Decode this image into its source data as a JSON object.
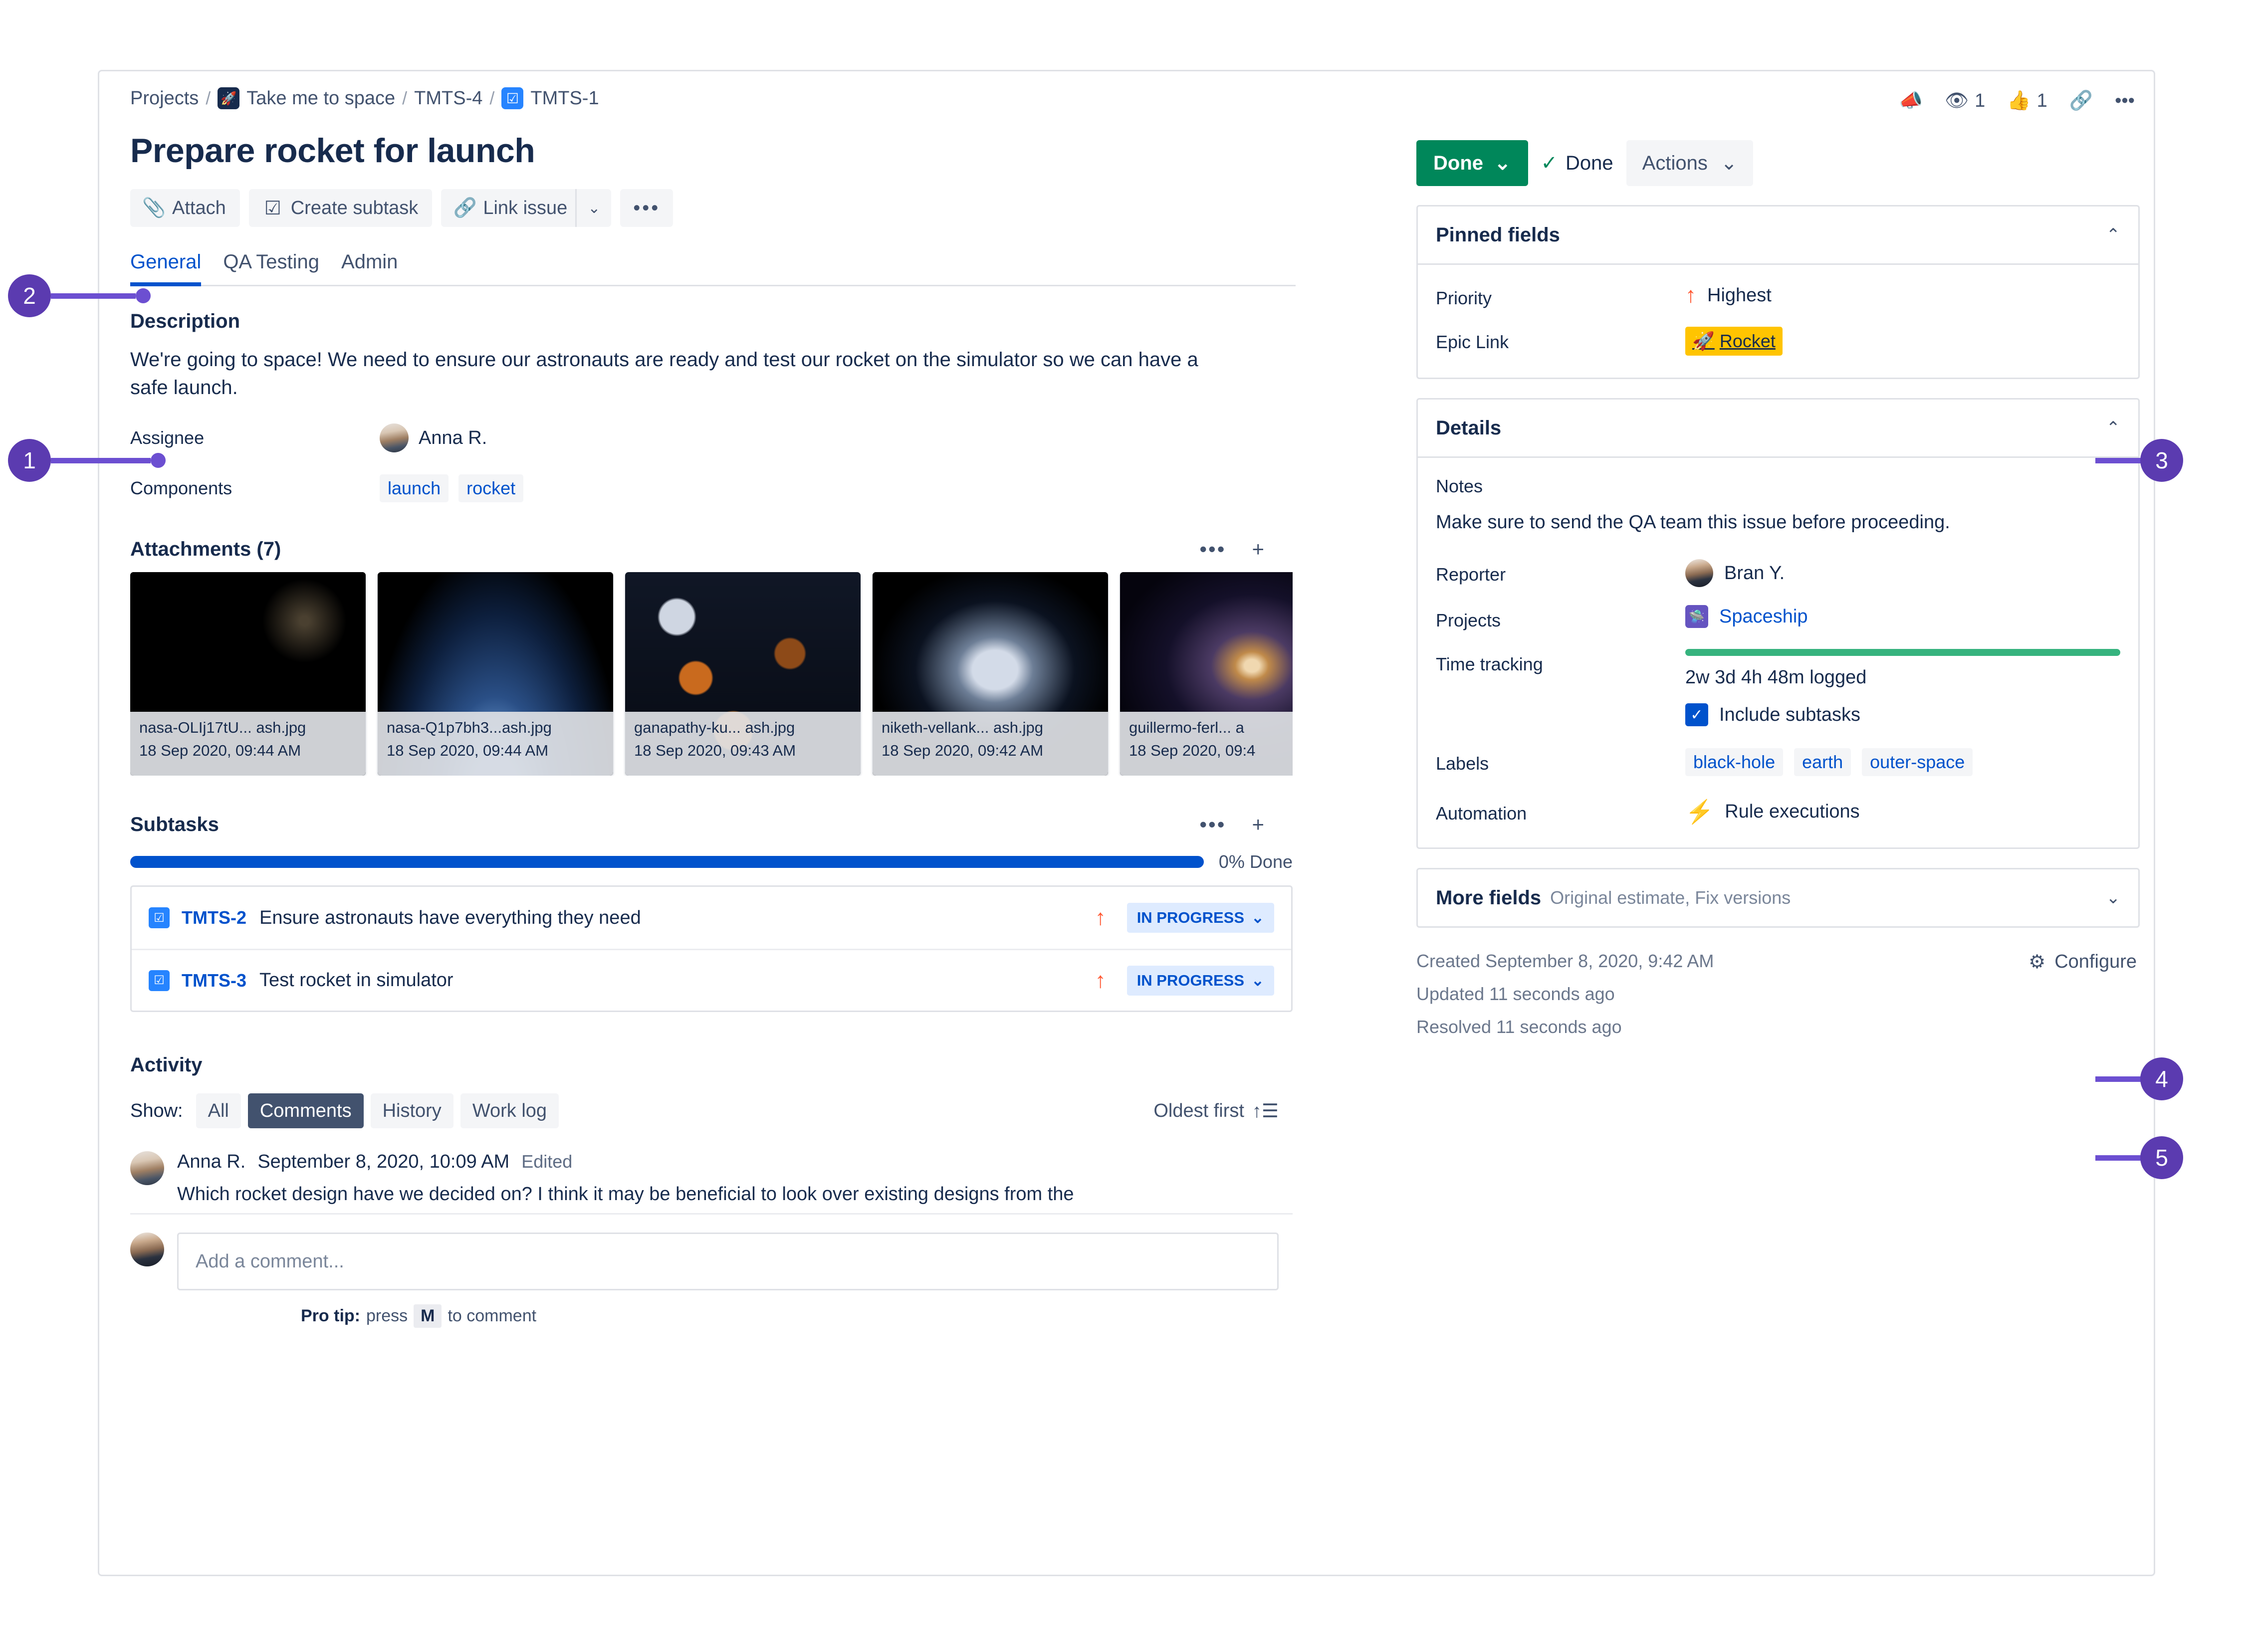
{
  "breadcrumb": {
    "projects": "Projects",
    "project_name": "Take me to space",
    "parent_key": "TMTS-4",
    "issue_key": "TMTS-1",
    "separator": "/",
    "project_icon": "rocket-icon",
    "issue_icon": "task-check-icon"
  },
  "issue": {
    "title": "Prepare rocket for launch"
  },
  "toolbar": {
    "attach": "Attach",
    "create_subtask": "Create subtask",
    "link_issue": "Link issue",
    "more": "•••",
    "caret": "⌄"
  },
  "tabs": [
    {
      "label": "General",
      "active": true
    },
    {
      "label": "QA Testing",
      "active": false
    },
    {
      "label": "Admin",
      "active": false
    }
  ],
  "description": {
    "heading": "Description",
    "text": "We're going to space! We need to ensure our astronauts are ready and test our rocket on the simulator so we can have a safe launch."
  },
  "fields": {
    "assignee_label": "Assignee",
    "assignee_name": "Anna R.",
    "components_label": "Components",
    "components": [
      "launch",
      "rocket"
    ]
  },
  "attachments": {
    "heading": "Attachments (7)",
    "more_icon": "•••",
    "add_icon": "+",
    "items": [
      {
        "name": "nasa-OLIj17tU... ash.jpg",
        "date": "18 Sep 2020, 09:44 AM",
        "style": "img-sat"
      },
      {
        "name": "nasa-Q1p7bh3...ash.jpg",
        "date": "18 Sep 2020, 09:44 AM",
        "style": "img-earth"
      },
      {
        "name": "ganapathy-ku... ash.jpg",
        "date": "18 Sep 2020, 09:43 AM",
        "style": "img-moon"
      },
      {
        "name": "niketh-vellank... ash.jpg",
        "date": "18 Sep 2020, 09:42 AM",
        "style": "img-astro"
      },
      {
        "name": "guillermo-ferl... a",
        "date": "18 Sep 2020, 09:4",
        "style": "img-gal"
      }
    ]
  },
  "subtasks": {
    "heading": "Subtasks",
    "more_icon": "•••",
    "add_icon": "+",
    "progress_percent": 0,
    "progress_label": "0% Done",
    "items": [
      {
        "key": "TMTS-2",
        "summary": "Ensure astronauts have everything they need",
        "priority": "↑",
        "status": "IN PROGRESS"
      },
      {
        "key": "TMTS-3",
        "summary": "Test rocket in simulator",
        "priority": "↑",
        "status": "IN PROGRESS"
      }
    ]
  },
  "activity": {
    "heading": "Activity",
    "show_label": "Show:",
    "filters": [
      {
        "label": "All",
        "active": false
      },
      {
        "label": "Comments",
        "active": true
      },
      {
        "label": "History",
        "active": false
      },
      {
        "label": "Work log",
        "active": false
      }
    ],
    "sort": "Oldest first",
    "sort_icon": "sort-ascending-icon",
    "comment": {
      "author": "Anna R.",
      "timestamp": "September 8, 2020, 10:09 AM",
      "edited": "Edited",
      "text": "Which rocket design have we decided on? I think it may be beneficial to look over existing designs from the"
    },
    "add_comment_placeholder": "Add a comment...",
    "pro_tip_prefix": "Pro tip:",
    "pro_tip_mid": "press",
    "pro_tip_key": "M",
    "pro_tip_suffix": "to comment"
  },
  "header_actions": {
    "watch_count": "1",
    "like_count": "1",
    "feedback_icon": "megaphone-icon",
    "watch_icon": "eye-icon",
    "like_icon": "thumbs-up-icon",
    "share_icon": "share-icon",
    "more_icon": "•••"
  },
  "status": {
    "current": "Done",
    "caret": "⌄",
    "resolution": "Done",
    "actions": "Actions"
  },
  "pinned_fields": {
    "title": "Pinned fields",
    "chevron": "⌃",
    "priority_label": "Priority",
    "priority_value": "Highest",
    "epic_label": "Epic Link",
    "epic_value": "Rocket"
  },
  "details": {
    "title": "Details",
    "chevron": "⌃",
    "notes_label": "Notes",
    "notes_text": "Make sure to send the QA team this issue before proceeding.",
    "reporter_label": "Reporter",
    "reporter_name": "Bran Y.",
    "projects_label": "Projects",
    "projects_value": "Spaceship",
    "time_tracking_label": "Time tracking",
    "time_logged": "2w 3d 4h 48m logged",
    "include_subtasks": "Include subtasks",
    "include_subtasks_checked": true,
    "labels_label": "Labels",
    "labels": [
      "black-hole",
      "earth",
      "outer-space"
    ],
    "automation_label": "Automation",
    "automation_value": "Rule executions",
    "automation_icon": "lightning-icon"
  },
  "more_fields": {
    "title": "More fields",
    "subtitle": "Original estimate, Fix versions",
    "chevron": "⌄"
  },
  "footer": {
    "created": "Created September 8, 2020, 9:42 AM",
    "updated": "Updated 11 seconds ago",
    "resolved": "Resolved 11 seconds ago",
    "configure": "Configure",
    "configure_icon": "gear-icon"
  },
  "callouts": [
    {
      "number": "1"
    },
    {
      "number": "2"
    },
    {
      "number": "3"
    },
    {
      "number": "4"
    },
    {
      "number": "5"
    }
  ],
  "colors": {
    "accent_blue": "#0052cc",
    "done_green": "#00875a",
    "priority_orange": "#ff5630",
    "epic_yellow": "#ffc400",
    "callout_purple": "#5b3bb0",
    "time_green": "#36b37e"
  }
}
